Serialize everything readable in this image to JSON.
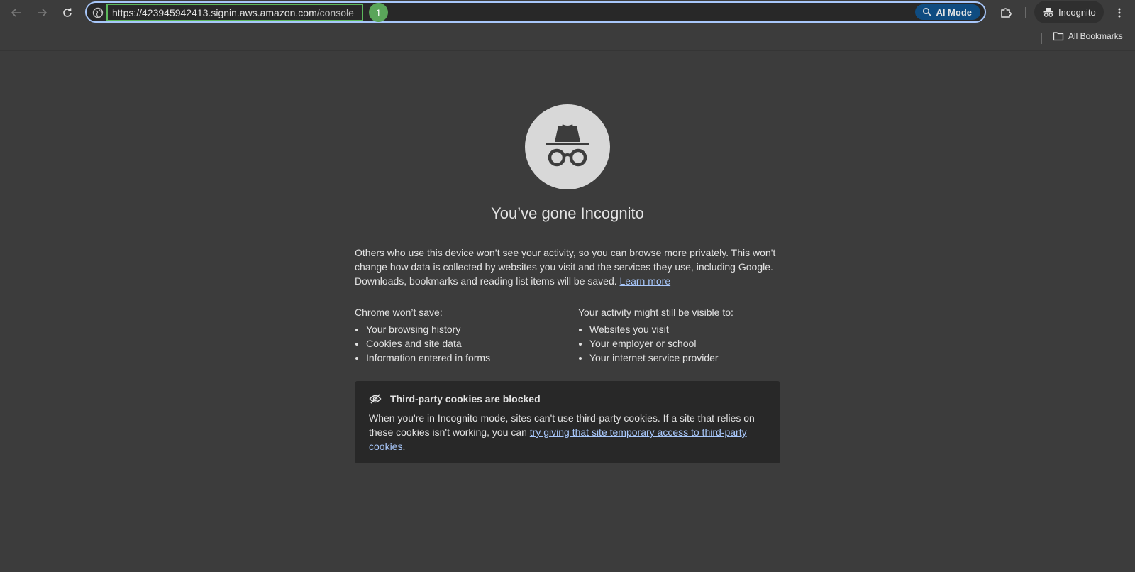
{
  "toolbar": {
    "back_icon": "arrow-left-icon",
    "forward_icon": "arrow-right-icon",
    "reload_icon": "reload-icon",
    "url_main": "https://423945942413.signin.aws.amazon.com",
    "url_path": "/console",
    "marker_label": "1",
    "ai_mode_label": "AI Mode",
    "incognito_label": "Incognito"
  },
  "bookmarks": {
    "all_bookmarks_label": "All Bookmarks"
  },
  "page": {
    "heading": "You’ve gone Incognito",
    "intro_text": "Others who use this device won’t see your activity, so you can browse more privately. This won't change how data is collected by websites you visit and the services they use, including Google. Downloads, bookmarks and reading list items will be saved.",
    "learn_more": "Learn more",
    "wont_save_title": "Chrome won’t save:",
    "wont_save_items": [
      "Your browsing history",
      "Cookies and site data",
      "Information entered in forms"
    ],
    "visible_title": "Your activity might still be visible to:",
    "visible_items": [
      "Websites you visit",
      "Your employer or school",
      "Your internet service provider"
    ],
    "cookie_title": "Third-party cookies are blocked",
    "cookie_text": "When you're in Incognito mode, sites can't use third-party cookies. If a site that relies on these cookies isn't working, you can",
    "cookie_link": "try giving that site temporary access to third-party cookies",
    "cookie_end": "."
  },
  "colors": {
    "background": "#3c3c3c",
    "link": "#a8c7fa",
    "ai_mode": "#0f4c81",
    "marker": "#5aa55a"
  }
}
